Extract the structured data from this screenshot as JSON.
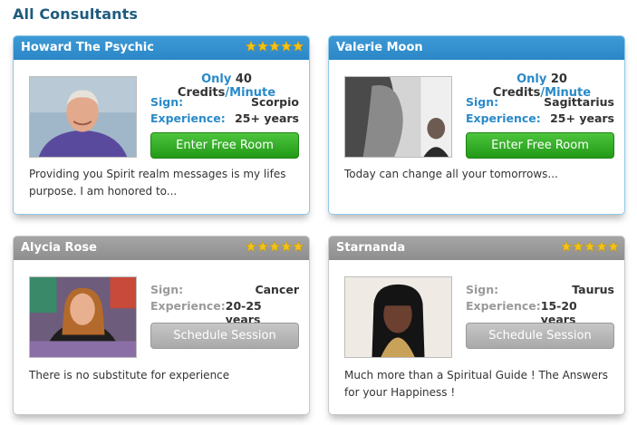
{
  "page_title": "All Consultants",
  "star_icon": "star-icon",
  "colors": {
    "online_header": "#2f8fcf",
    "offline_header": "#999999",
    "accent_blue": "#2a8ac9",
    "enter_button": "#2fae22",
    "schedule_button": "#b3b3b3",
    "title": "#1f5b7e",
    "star": "#f2c31b"
  },
  "consultants": [
    {
      "name": "Howard The Psychic",
      "rating_stars": 5,
      "status": "online",
      "price_prefix": "Only",
      "price_amount": "40 Credits",
      "price_unit": "/Minute",
      "sign_label": "Sign:",
      "sign": "Scorpio",
      "experience_label": "Experience:",
      "experience": "25+ years",
      "action_label": "Enter Free Room",
      "description": "Providing you Spirit realm messages is my lifes purpose. I am honored to..."
    },
    {
      "name": "Valerie Moon",
      "rating_stars": 5,
      "status": "online",
      "price_prefix": "Only",
      "price_amount": "20 Credits",
      "price_unit": "/Minute",
      "sign_label": "Sign:",
      "sign": "Sagittarius",
      "experience_label": "Experience:",
      "experience": "25+ years",
      "action_label": "Enter Free Room",
      "description": "Today can change all your tomorrows..."
    },
    {
      "name": "Alycia Rose",
      "rating_stars": 5,
      "status": "offline",
      "sign_label": "Sign:",
      "sign": "Cancer",
      "experience_label": "Experience:",
      "experience": "20-25 years",
      "action_label": "Schedule Session",
      "description": "There is no substitute for experience"
    },
    {
      "name": "Starnanda",
      "rating_stars": 5,
      "status": "offline",
      "sign_label": "Sign:",
      "sign": "Taurus",
      "experience_label": "Experience:",
      "experience": "15-20 years",
      "action_label": "Schedule Session",
      "description": "Much more than a Spiritual Guide ! The Answers for your Happiness !"
    }
  ]
}
